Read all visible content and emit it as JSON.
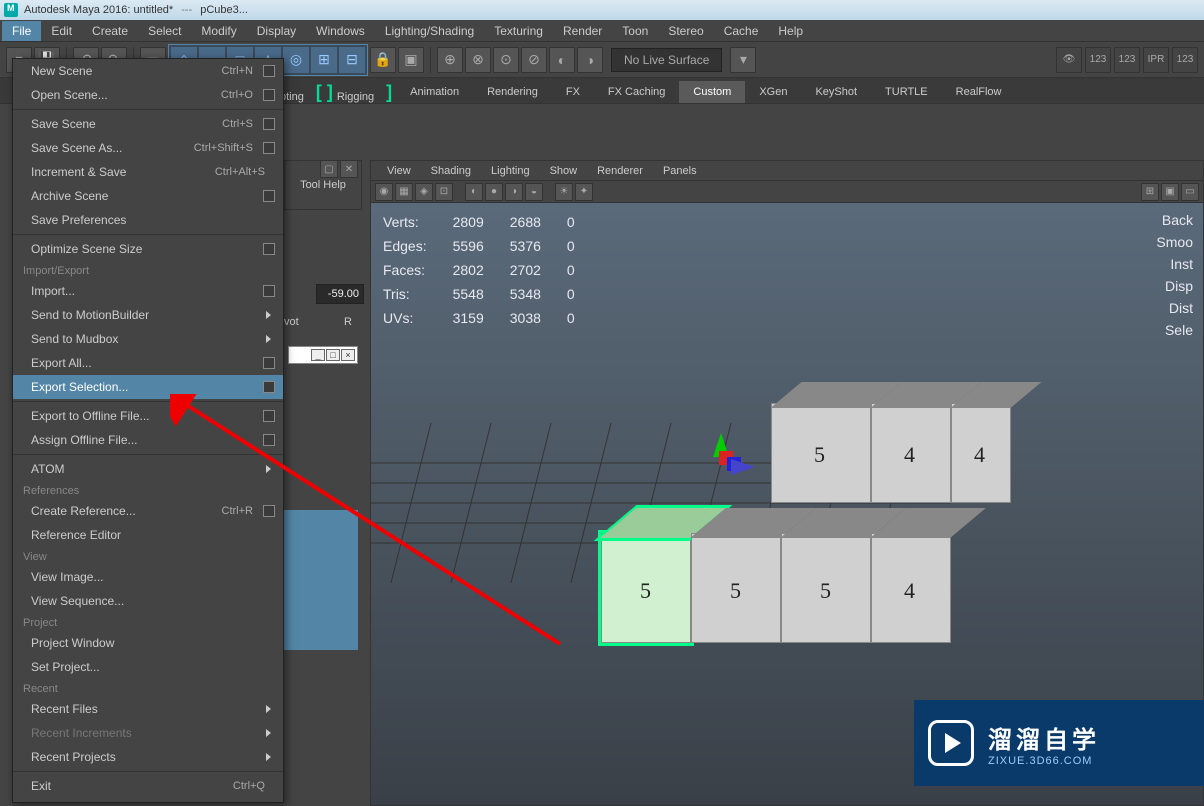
{
  "title": {
    "app": "Autodesk Maya 2016: untitled*",
    "sep": "---",
    "obj": "pCube3..."
  },
  "menubar": [
    "File",
    "Edit",
    "Create",
    "Select",
    "Modify",
    "Display",
    "Windows",
    "Lighting/Shading",
    "Texturing",
    "Render",
    "Toon",
    "Stereo",
    "Cache",
    "Help"
  ],
  "menubar_active": 0,
  "live_surface": "No Live Surface",
  "render_icons": [
    "123",
    "123",
    "IPR",
    "123"
  ],
  "shelf": {
    "bracket1": "pting",
    "bracket2": "Rigging",
    "tabs": [
      "Animation",
      "Rendering",
      "FX",
      "FX Caching",
      "Custom",
      "XGen",
      "KeyShot",
      "TURTLE",
      "RealFlow"
    ],
    "active": 4
  },
  "tool_help": "Tool Help",
  "numval": "-59.00",
  "pivot": "vot",
  "rlabel": "R",
  "filemenu": [
    {
      "lbl": "New Scene",
      "sc": "Ctrl+N",
      "box": true
    },
    {
      "lbl": "Open Scene...",
      "sc": "Ctrl+O",
      "box": true
    },
    {
      "sep": true
    },
    {
      "lbl": "Save Scene",
      "sc": "Ctrl+S",
      "box": true
    },
    {
      "lbl": "Save Scene As...",
      "sc": "Ctrl+Shift+S",
      "box": true
    },
    {
      "lbl": "Increment & Save",
      "sc": "Ctrl+Alt+S"
    },
    {
      "lbl": "Archive Scene",
      "box": true
    },
    {
      "lbl": "Save Preferences"
    },
    {
      "sep": true
    },
    {
      "lbl": "Optimize Scene Size",
      "box": true
    },
    {
      "hdr": "Import/Export"
    },
    {
      "lbl": "Import...",
      "box": true
    },
    {
      "lbl": "Send to MotionBuilder",
      "arrow": true
    },
    {
      "lbl": "Send to Mudbox",
      "arrow": true
    },
    {
      "lbl": "Export All...",
      "box": true
    },
    {
      "lbl": "Export Selection...",
      "box": true,
      "hl": true
    },
    {
      "sep": true
    },
    {
      "lbl": "Export to Offline File...",
      "box": true
    },
    {
      "lbl": "Assign Offline File...",
      "box": true
    },
    {
      "sep": true
    },
    {
      "lbl": "ATOM",
      "arrow": true
    },
    {
      "hdr": "References"
    },
    {
      "lbl": "Create Reference...",
      "sc": "Ctrl+R",
      "box": true
    },
    {
      "lbl": "Reference Editor"
    },
    {
      "hdr": "View"
    },
    {
      "lbl": "View Image..."
    },
    {
      "lbl": "View Sequence..."
    },
    {
      "hdr": "Project"
    },
    {
      "lbl": "Project Window"
    },
    {
      "lbl": "Set Project..."
    },
    {
      "hdr": "Recent"
    },
    {
      "lbl": "Recent Files",
      "arrow": true
    },
    {
      "lbl": "Recent Increments",
      "arrow": true,
      "dis": true
    },
    {
      "lbl": "Recent Projects",
      "arrow": true
    },
    {
      "sep": true
    },
    {
      "lbl": "Exit",
      "sc": "Ctrl+Q"
    }
  ],
  "vp_menu": [
    "View",
    "Shading",
    "Lighting",
    "Show",
    "Renderer",
    "Panels"
  ],
  "hud": {
    "rows": [
      [
        "Verts:",
        "2809",
        "2688",
        "0"
      ],
      [
        "Edges:",
        "5596",
        "5376",
        "0"
      ],
      [
        "Faces:",
        "2802",
        "2702",
        "0"
      ],
      [
        "Tris:",
        "5548",
        "5348",
        "0"
      ],
      [
        "UVs:",
        "3159",
        "3038",
        "0"
      ]
    ],
    "right": [
      "Back",
      "Smoo",
      "Inst",
      "Disp",
      "Dist",
      "Sele"
    ]
  },
  "cube_labels": {
    "a": "5",
    "b": "4",
    "c": "4",
    "d": "5",
    "e": "5",
    "f": "5",
    "g": "4"
  },
  "watermark": {
    "cn": "溜溜自学",
    "en": "ZIXUE.3D66.COM"
  }
}
